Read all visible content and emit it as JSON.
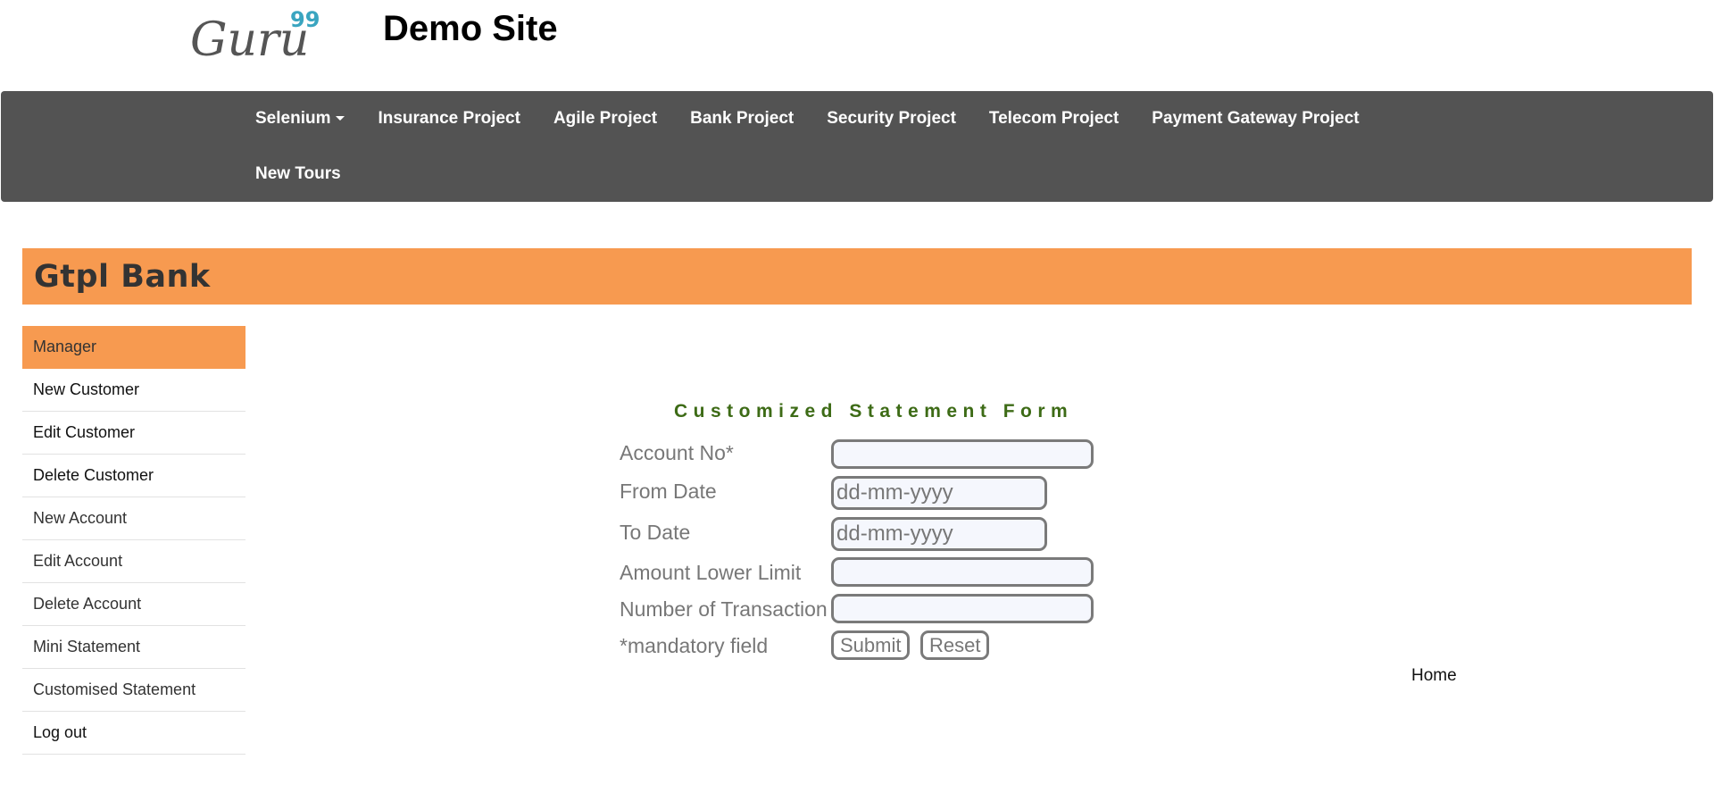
{
  "header": {
    "logo_text": "Guru",
    "logo_superscript": "99",
    "site_title": "Demo Site"
  },
  "nav": {
    "row1": [
      {
        "label": "Selenium",
        "has_caret": true
      },
      {
        "label": "Insurance Project"
      },
      {
        "label": "Agile Project"
      },
      {
        "label": "Bank Project"
      },
      {
        "label": "Security Project"
      },
      {
        "label": "Telecom Project"
      },
      {
        "label": "Payment Gateway Project"
      }
    ],
    "row2": [
      {
        "label": "New Tours"
      }
    ]
  },
  "bank": {
    "name": "Gtpl Bank"
  },
  "sidebar": {
    "items": [
      {
        "label": "Manager",
        "active": true
      },
      {
        "label": "New Customer"
      },
      {
        "label": "Edit Customer"
      },
      {
        "label": "Delete Customer"
      },
      {
        "label": "New Account"
      },
      {
        "label": "Edit Account"
      },
      {
        "label": "Delete Account"
      },
      {
        "label": "Mini Statement"
      },
      {
        "label": "Customised Statement"
      },
      {
        "label": "Log out"
      }
    ]
  },
  "form": {
    "title": "Customized Statement Form",
    "account_no_label": "Account No*",
    "account_no_value": "",
    "from_date_label": "From Date",
    "from_date_placeholder": "dd-mm-yyyy",
    "to_date_label": "To Date",
    "to_date_placeholder": "dd-mm-yyyy",
    "amount_lower_limit_label": "Amount Lower Limit",
    "amount_lower_limit_value": "",
    "num_transaction_label": "Number of Transaction",
    "num_transaction_value": "",
    "mandatory_note": "*mandatory field",
    "submit_label": "Submit",
    "reset_label": "Reset"
  },
  "footer": {
    "home_label": "Home"
  },
  "colors": {
    "navbar_bg": "#535353",
    "accent_orange": "#f79a50",
    "form_title_green": "#3d6b16",
    "logo_dark": "#555555",
    "logo_teal": "#3aa5c0"
  }
}
